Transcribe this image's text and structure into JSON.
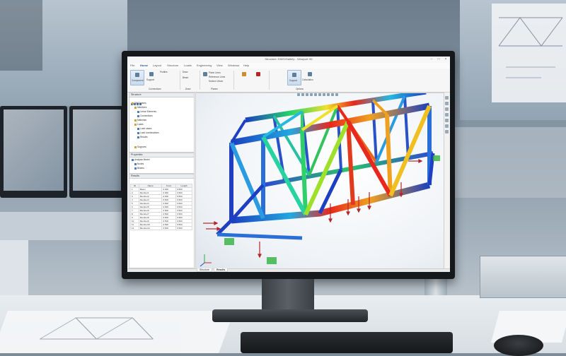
{
  "app": {
    "title": "Structure: DWO/Gallery - Viewport 3D",
    "window_controls": [
      "–",
      "□",
      "×"
    ],
    "tabs": [
      "File",
      "Home",
      "Layout",
      "Structure",
      "Loads",
      "Engineering",
      "View",
      "Windows",
      "Help"
    ],
    "active_tab": "Home",
    "ribbon": {
      "groups": [
        {
          "label": "Connections",
          "buttons": [
            "Component",
            "Support",
            "Profiles"
          ]
        },
        {
          "label": "Draw",
          "buttons": [
            "Draw",
            "Beam"
          ]
        },
        {
          "label": "Planes",
          "buttons": [
            "Plane Lines",
            "Reference Lines",
            "Section Views"
          ]
        },
        {
          "label": "Options",
          "buttons": [
            "Support",
            "Calculation"
          ]
        }
      ]
    },
    "panels": {
      "structure": {
        "title": "Structure",
        "items": [
          "DWOgrams",
          "Members",
          "Linear Elements",
          "Connections",
          "Materials",
          "Loads",
          "Load cases",
          "Load combinations",
          "Results",
          "Supports"
        ]
      },
      "properties": {
        "title": "Properties",
        "items": [
          "Analysis Model",
          "Nodes",
          "Beams"
        ]
      },
      "results": {
        "title": "Results",
        "columns": [
          "ID",
          "Name",
          "From",
          "Length"
        ],
        "rows": [
          [
            "1",
            "Beam",
            "0.000",
            "0.500"
          ],
          [
            "2",
            "Member1",
            "0.000",
            "0.500"
          ],
          [
            "3",
            "Member2",
            "0.000",
            "0.500"
          ],
          [
            "4",
            "Member3",
            "0.500",
            "0.500"
          ],
          [
            "5",
            "Member4",
            "0.500",
            "0.500"
          ],
          [
            "6",
            "Member5",
            "0.500",
            "0.500"
          ],
          [
            "7",
            "Member6",
            "0.500",
            "0.500"
          ],
          [
            "8",
            "Member7",
            "0.500",
            "0.500"
          ],
          [
            "9",
            "Member8",
            "0.500",
            "0.500"
          ],
          [
            "10",
            "Member9",
            "0.500",
            "0.500"
          ],
          [
            "11",
            "Member10",
            "0.500",
            "0.500"
          ],
          [
            "12",
            "Member11",
            "0.500",
            "0.500"
          ]
        ]
      }
    },
    "bottom_tabs": [
      "Structure",
      "Results"
    ],
    "active_bottom_tab": "Results",
    "colors": {
      "accent": "#1d5fa5",
      "stress_low": "#1b3fbf",
      "stress_mid": "#27d36a",
      "stress_high": "#e8281c",
      "load_arrow": "#b3262a",
      "support": "#3bb54a"
    },
    "icons": [
      "model-icon",
      "node-icon",
      "beam-icon",
      "support-icon",
      "load-icon",
      "settings-icon"
    ]
  }
}
